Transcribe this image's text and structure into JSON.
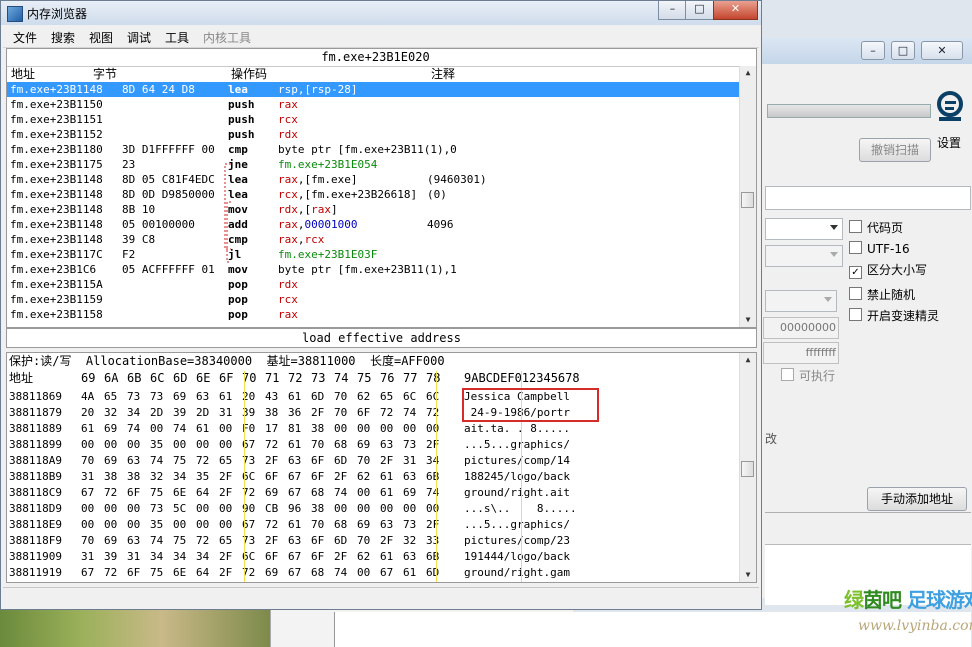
{
  "window": {
    "title": "内存浏览器"
  },
  "menu": [
    "文件",
    "搜索",
    "视图",
    "调试",
    "工具",
    "内核工具"
  ],
  "disasm": {
    "header": "fm.exe+23B1E020",
    "columns": {
      "address": "地址",
      "bytes": "字节",
      "opcode": "操作码",
      "comment": "注释"
    },
    "rows": [
      {
        "addr": "fm.exe+23B1148",
        "bytes": "8D 64 24 D8",
        "op": "lea",
        "args": [
          {
            "t": "rsp",
            "c": "reg"
          },
          {
            "t": ",",
            "c": ""
          },
          {
            "t": "[rsp-28]",
            "c": "reg"
          }
        ],
        "cmt": "",
        "sel": true
      },
      {
        "addr": "fm.exe+23B1150",
        "bytes": "",
        "op": "push",
        "args": [
          {
            "t": "rax",
            "c": "reg"
          }
        ],
        "cmt": ""
      },
      {
        "addr": "fm.exe+23B1151",
        "bytes": "",
        "op": "push",
        "args": [
          {
            "t": "rcx",
            "c": "reg"
          }
        ],
        "cmt": ""
      },
      {
        "addr": "fm.exe+23B1152",
        "bytes": "",
        "op": "push",
        "args": [
          {
            "t": "rdx",
            "c": "reg"
          }
        ],
        "cmt": ""
      },
      {
        "addr": "fm.exe+23B1180",
        "bytes": "3D D1FFFFFF 00",
        "op": "cmp",
        "args": [
          {
            "t": "byte ptr [fm.exe+23B11(1),0",
            "c": ""
          }
        ],
        "cmt": ""
      },
      {
        "addr": "fm.exe+23B1175",
        "bytes": "23",
        "op": "jne",
        "args": [
          {
            "t": "fm.exe+23B1E054",
            "c": "grn"
          }
        ],
        "cmt": ""
      },
      {
        "addr": "fm.exe+23B1148",
        "bytes": "8D 05 C81F4EDC",
        "op": "lea",
        "args": [
          {
            "t": "rax",
            "c": "reg"
          },
          {
            "t": ",[fm.exe]",
            "c": ""
          }
        ],
        "cmt": "(9460301)"
      },
      {
        "addr": "fm.exe+23B1148",
        "bytes": "8D 0D D9850000",
        "op": "lea",
        "args": [
          {
            "t": "rcx",
            "c": "reg"
          },
          {
            "t": ",[fm.exe+23B26618]",
            "c": ""
          }
        ],
        "cmt": "(0)"
      },
      {
        "addr": "fm.exe+23B1148",
        "bytes": "8B 10",
        "op": "mov",
        "args": [
          {
            "t": "rdx",
            "c": "reg"
          },
          {
            "t": ",[",
            "c": ""
          },
          {
            "t": "rax",
            "c": "reg"
          },
          {
            "t": "]",
            "c": ""
          }
        ],
        "cmt": ""
      },
      {
        "addr": "fm.exe+23B1148",
        "bytes": "05 00100000",
        "op": "add",
        "args": [
          {
            "t": "rax",
            "c": "reg"
          },
          {
            "t": ",",
            "c": ""
          },
          {
            "t": "00001000",
            "c": "num"
          }
        ],
        "cmt": "4096"
      },
      {
        "addr": "fm.exe+23B1148",
        "bytes": "39 C8",
        "op": "cmp",
        "args": [
          {
            "t": "rax",
            "c": "reg"
          },
          {
            "t": ",",
            "c": ""
          },
          {
            "t": "rcx",
            "c": "reg"
          }
        ],
        "cmt": ""
      },
      {
        "addr": "fm.exe+23B117C",
        "bytes": "F2",
        "op": "jl",
        "args": [
          {
            "t": "fm.exe+23B1E03F",
            "c": "grn"
          }
        ],
        "cmt": ""
      },
      {
        "addr": "fm.exe+23B1C6",
        "bytes": "05 ACFFFFFF 01",
        "op": "mov",
        "args": [
          {
            "t": "byte ptr [fm.exe+23B11(1),1",
            "c": ""
          }
        ],
        "cmt": ""
      },
      {
        "addr": "fm.exe+23B115A",
        "bytes": "",
        "op": "pop",
        "args": [
          {
            "t": "rdx",
            "c": "reg"
          }
        ],
        "cmt": ""
      },
      {
        "addr": "fm.exe+23B1159",
        "bytes": "",
        "op": "pop",
        "args": [
          {
            "t": "rcx",
            "c": "reg"
          }
        ],
        "cmt": ""
      },
      {
        "addr": "fm.exe+23B1158",
        "bytes": "",
        "op": "pop",
        "args": [
          {
            "t": "rax",
            "c": "reg"
          }
        ],
        "cmt": ""
      }
    ]
  },
  "status": "load effective address",
  "hex": {
    "info": "保护:读/写  AllocationBase=38340000  基址=38811000  长度=AFF000",
    "header_label": "地址",
    "header_cols": [
      "69",
      "6A",
      "6B",
      "6C",
      "6D",
      "6E",
      "6F",
      "70",
      "71",
      "72",
      "73",
      "74",
      "75",
      "76",
      "77",
      "78"
    ],
    "ascii_header": "9ABCDEF012345678",
    "rows": [
      {
        "addr": "38811869",
        "bytes": [
          "4A",
          "65",
          "73",
          "73",
          "69",
          "63",
          "61",
          "20",
          "43",
          "61",
          "6D",
          "70",
          "62",
          "65",
          "6C",
          "6C"
        ],
        "ascii": "Jessica Campbell"
      },
      {
        "addr": "38811879",
        "bytes": [
          "20",
          "32",
          "34",
          "2D",
          "39",
          "2D",
          "31",
          "39",
          "38",
          "36",
          "2F",
          "70",
          "6F",
          "72",
          "74",
          "72"
        ],
        "ascii": " 24-9-1986/portr"
      },
      {
        "addr": "38811889",
        "bytes": [
          "61",
          "69",
          "74",
          "00",
          "74",
          "61",
          "00",
          "F0",
          "17",
          "81",
          "38",
          "00",
          "00",
          "00",
          "00",
          "00"
        ],
        "ascii": "ait.ta. . 8....."
      },
      {
        "addr": "38811899",
        "bytes": [
          "00",
          "00",
          "00",
          "35",
          "00",
          "00",
          "00",
          "67",
          "72",
          "61",
          "70",
          "68",
          "69",
          "63",
          "73",
          "2F"
        ],
        "ascii": "...5...graphics/"
      },
      {
        "addr": "388118A9",
        "bytes": [
          "70",
          "69",
          "63",
          "74",
          "75",
          "72",
          "65",
          "73",
          "2F",
          "63",
          "6F",
          "6D",
          "70",
          "2F",
          "31",
          "34"
        ],
        "ascii": "pictures/comp/14"
      },
      {
        "addr": "388118B9",
        "bytes": [
          "31",
          "38",
          "38",
          "32",
          "34",
          "35",
          "2F",
          "6C",
          "6F",
          "67",
          "6F",
          "2F",
          "62",
          "61",
          "63",
          "6B"
        ],
        "ascii": "188245/logo/back"
      },
      {
        "addr": "388118C9",
        "bytes": [
          "67",
          "72",
          "6F",
          "75",
          "6E",
          "64",
          "2F",
          "72",
          "69",
          "67",
          "68",
          "74",
          "00",
          "61",
          "69",
          "74"
        ],
        "ascii": "ground/right.ait"
      },
      {
        "addr": "388118D9",
        "bytes": [
          "00",
          "00",
          "00",
          "73",
          "5C",
          "00",
          "00",
          "90",
          "CB",
          "96",
          "38",
          "00",
          "00",
          "00",
          "00",
          "00"
        ],
        "ascii": "...s\\..    8....."
      },
      {
        "addr": "388118E9",
        "bytes": [
          "00",
          "00",
          "00",
          "35",
          "00",
          "00",
          "00",
          "67",
          "72",
          "61",
          "70",
          "68",
          "69",
          "63",
          "73",
          "2F"
        ],
        "ascii": "...5...graphics/"
      },
      {
        "addr": "388118F9",
        "bytes": [
          "70",
          "69",
          "63",
          "74",
          "75",
          "72",
          "65",
          "73",
          "2F",
          "63",
          "6F",
          "6D",
          "70",
          "2F",
          "32",
          "33"
        ],
        "ascii": "pictures/comp/23"
      },
      {
        "addr": "38811909",
        "bytes": [
          "31",
          "39",
          "31",
          "34",
          "34",
          "34",
          "2F",
          "6C",
          "6F",
          "67",
          "6F",
          "2F",
          "62",
          "61",
          "63",
          "6B"
        ],
        "ascii": "191444/logo/back"
      },
      {
        "addr": "38811919",
        "bytes": [
          "67",
          "72",
          "6F",
          "75",
          "6E",
          "64",
          "2F",
          "72",
          "69",
          "67",
          "68",
          "74",
          "00",
          "67",
          "61",
          "6D"
        ],
        "ascii": "ground/right.gam"
      }
    ]
  },
  "background": {
    "settings_label": "设置",
    "undo_scan": "撤销扫描",
    "hex1": "00000000",
    "hex2": "ffffffff",
    "checkboxes": [
      {
        "label": "代码页",
        "checked": false
      },
      {
        "label": "UTF-16",
        "checked": false
      },
      {
        "label": "区分大小写",
        "checked": true
      },
      {
        "label": "禁止随机",
        "checked": false
      },
      {
        "label": "开启变速精灵",
        "checked": false
      }
    ],
    "executable": "可执行",
    "add_address": "手动添加地址",
    "fragment": "改"
  },
  "watermark": {
    "title_a": "绿",
    "title_b": "茵吧",
    "title_c": " 足球游戏网",
    "url": "www.lvyinba.com"
  },
  "colors": {
    "selection": "#3399ff",
    "register": "#c00000",
    "label": "#0a8a0a",
    "number": "#0000c0",
    "highlight_box": "#d62b2b"
  }
}
